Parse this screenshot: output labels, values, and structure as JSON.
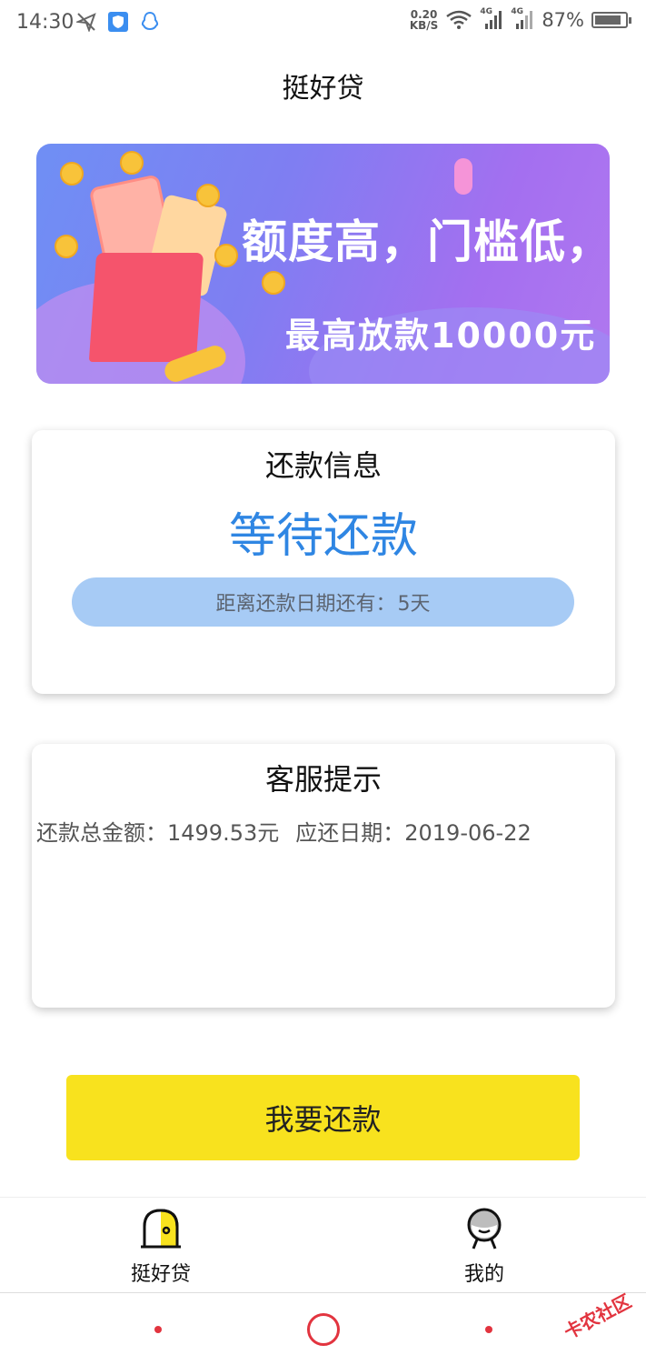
{
  "status_bar": {
    "time": "14:30",
    "network_speed": "0.20",
    "network_unit": "KB/S",
    "signal1_label": "4G",
    "signal2_label": "4G",
    "battery_percent": "87%",
    "battery_level": 0.87,
    "icons": [
      "send-icon",
      "shield-icon",
      "qq-icon",
      "wifi-icon",
      "signal-icon",
      "battery-icon"
    ]
  },
  "header": {
    "title": "挺好贷"
  },
  "banner": {
    "headline": "额度高，门槛低，下款快",
    "subline": "最高放款10000元"
  },
  "repayment_card": {
    "title": "还款信息",
    "status": "等待还款",
    "countdown_label": "距离还款日期还有：",
    "countdown_value": "5天"
  },
  "service_card": {
    "title": "客服提示",
    "amount_label": "还款总金额：",
    "amount_value": "1499.53元",
    "due_label": "应还日期：",
    "due_value": "2019-06-22"
  },
  "actions": {
    "repay_button": "我要还款"
  },
  "tabbar": {
    "items": [
      {
        "label": "挺好贷",
        "icon": "home-dome-icon"
      },
      {
        "label": "我的",
        "icon": "user-face-icon"
      }
    ]
  },
  "watermark": "卡农社区",
  "colors": {
    "status_blue": "#2f86e3",
    "pill_blue": "#a7cbf5",
    "button_yellow": "#f8e21e",
    "nav_red": "#e2343f"
  }
}
